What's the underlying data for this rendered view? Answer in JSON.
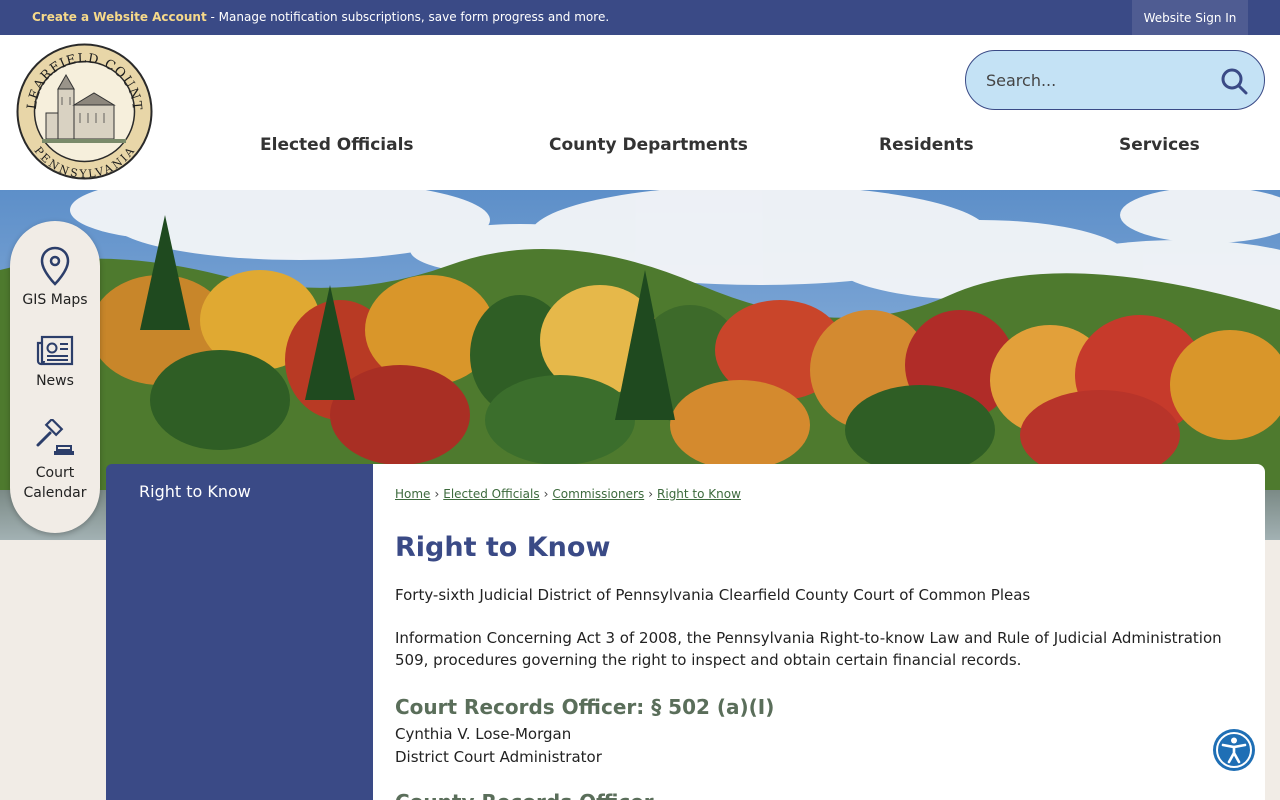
{
  "topbar": {
    "account_link": "Create a Website Account",
    "account_message": " - Manage notification subscriptions, save form progress and more.",
    "signin_label": "Website Sign In"
  },
  "logo": {
    "top_text": "CLEARFIELD COUNTY",
    "bottom_text": "PENNSYLVANIA",
    "icon": "county-seal-icon"
  },
  "search": {
    "placeholder": "Search...",
    "icon": "search-icon"
  },
  "nav": {
    "items": [
      {
        "label": "Elected Officials"
      },
      {
        "label": "County Departments"
      },
      {
        "label": "Residents"
      },
      {
        "label": "Services"
      }
    ]
  },
  "quick_links": [
    {
      "label": "GIS Maps",
      "icon": "map-pin-icon"
    },
    {
      "label": "News",
      "icon": "newspaper-icon"
    },
    {
      "label": "Court Calendar",
      "icon": "gavel-icon"
    }
  ],
  "sidebar": {
    "items": [
      {
        "label": "Right to Know"
      }
    ]
  },
  "breadcrumb": {
    "items": [
      {
        "label": "Home"
      },
      {
        "label": "Elected Officials"
      },
      {
        "label": "Commissioners"
      },
      {
        "label": "Right to Know"
      }
    ],
    "separator": "›"
  },
  "main": {
    "title": "Right to Know",
    "paragraph1": "Forty-sixth Judicial District of Pennsylvania Clearfield County Court of Common Pleas",
    "paragraph2": "Information Concerning Act 3 of 2008, the Pennsylvania Right-to-know Law and Rule of Judicial Administration 509, procedures governing the right to inspect and obtain certain financial records.",
    "section1_heading": "Court Records Officer: § 502 (a)(I)",
    "section1_line1": "Cynthia V. Lose-Morgan",
    "section1_line2": "District Court Administrator",
    "section2_heading": "County Records Officer"
  },
  "accessibility": {
    "icon": "accessibility-icon"
  },
  "colors": {
    "brand_blue": "#3a4a86",
    "heading_green": "#5a6e5a",
    "search_bg": "#c4e2f5",
    "accent_gold": "#f6d98a"
  }
}
